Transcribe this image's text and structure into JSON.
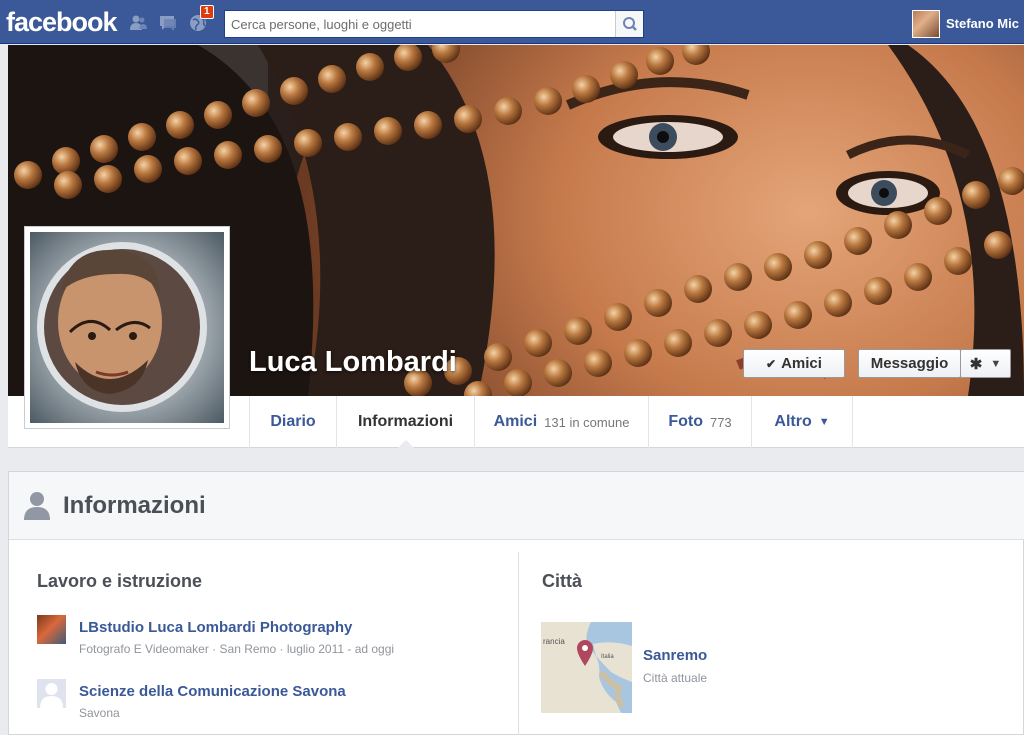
{
  "topbar": {
    "logo": "facebook",
    "notification_count": "1",
    "search_placeholder": "Cerca persone, luoghi e oggetti",
    "user_name": "Stefano Mic"
  },
  "profile": {
    "name": "Luca Lombardi",
    "friends_button": "Amici",
    "message_button": "Messaggio"
  },
  "tabs": [
    {
      "label": "Diario",
      "count": ""
    },
    {
      "label": "Informazioni",
      "count": ""
    },
    {
      "label": "Amici",
      "count": "131 in comune"
    },
    {
      "label": "Foto",
      "count": "773"
    },
    {
      "label": "Altro",
      "count": ""
    }
  ],
  "info": {
    "title": "Informazioni",
    "work_section_title": "Lavoro e istruzione",
    "work": [
      {
        "title": "LBstudio Luca Lombardi Photography",
        "subtitle": "Fotografo E Videomaker · San Remo · luglio 2011 - ad oggi"
      },
      {
        "title": "Scienze della Comunicazione Savona",
        "subtitle": "Savona"
      }
    ],
    "city_section_title": "Città",
    "city": {
      "name": "Sanremo",
      "subtitle": "Città attuale",
      "map_label_left": "rancia",
      "map_label_right": "Italia"
    }
  },
  "colors": {
    "brand_blue": "#3b5998",
    "link_blue": "#3b5998",
    "badge_red": "#dd3c10",
    "page_bg": "#e9ebee",
    "map_pin": "#b0475e"
  },
  "icons": [
    "friends-icon",
    "messages-icon",
    "globe-icon",
    "search-icon",
    "check-icon",
    "gear-icon",
    "chevron-down-icon",
    "person-icon",
    "map-pin-icon"
  ]
}
